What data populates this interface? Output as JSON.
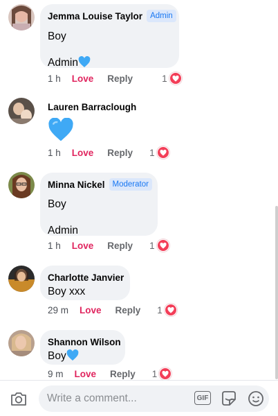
{
  "comments": [
    {
      "author": "Jemma Louise Taylor",
      "badge": "Admin",
      "line1": "Boy",
      "line2": "Admin",
      "time": "1 h",
      "love": "Love",
      "reply": "Reply",
      "reaction_count": "1"
    },
    {
      "author": "Lauren Barraclough",
      "time": "1 h",
      "love": "Love",
      "reply": "Reply",
      "reaction_count": "1"
    },
    {
      "author": "Minna Nickel",
      "badge": "Moderator",
      "line1": "Boy",
      "line2": "Admin",
      "time": "1 h",
      "love": "Love",
      "reply": "Reply",
      "reaction_count": "1"
    },
    {
      "author": "Charlotte Janvier",
      "line1": "Boy xxx",
      "time": "29 m",
      "love": "Love",
      "reply": "Reply",
      "reaction_count": "1"
    },
    {
      "author": "Shannon Wilson",
      "line1": "Boy",
      "time": "9 m",
      "love": "Love",
      "reply": "Reply",
      "reaction_count": "1"
    }
  ],
  "composer": {
    "placeholder": "Write a comment...",
    "gif_label": "GIF"
  },
  "icons": {
    "emoji": "blue-heart",
    "reaction": "heart-reaction",
    "camera": "camera-icon",
    "sticker": "sticker-icon",
    "emoji_picker": "smiley-icon"
  },
  "colors": {
    "love": "#e0245e",
    "badge_text": "#1877f2",
    "badge_bg": "#dbe7fb",
    "bubble": "#f0f2f5",
    "reaction_heart": "#f33e58",
    "blue_heart": "#3fa9f5"
  }
}
